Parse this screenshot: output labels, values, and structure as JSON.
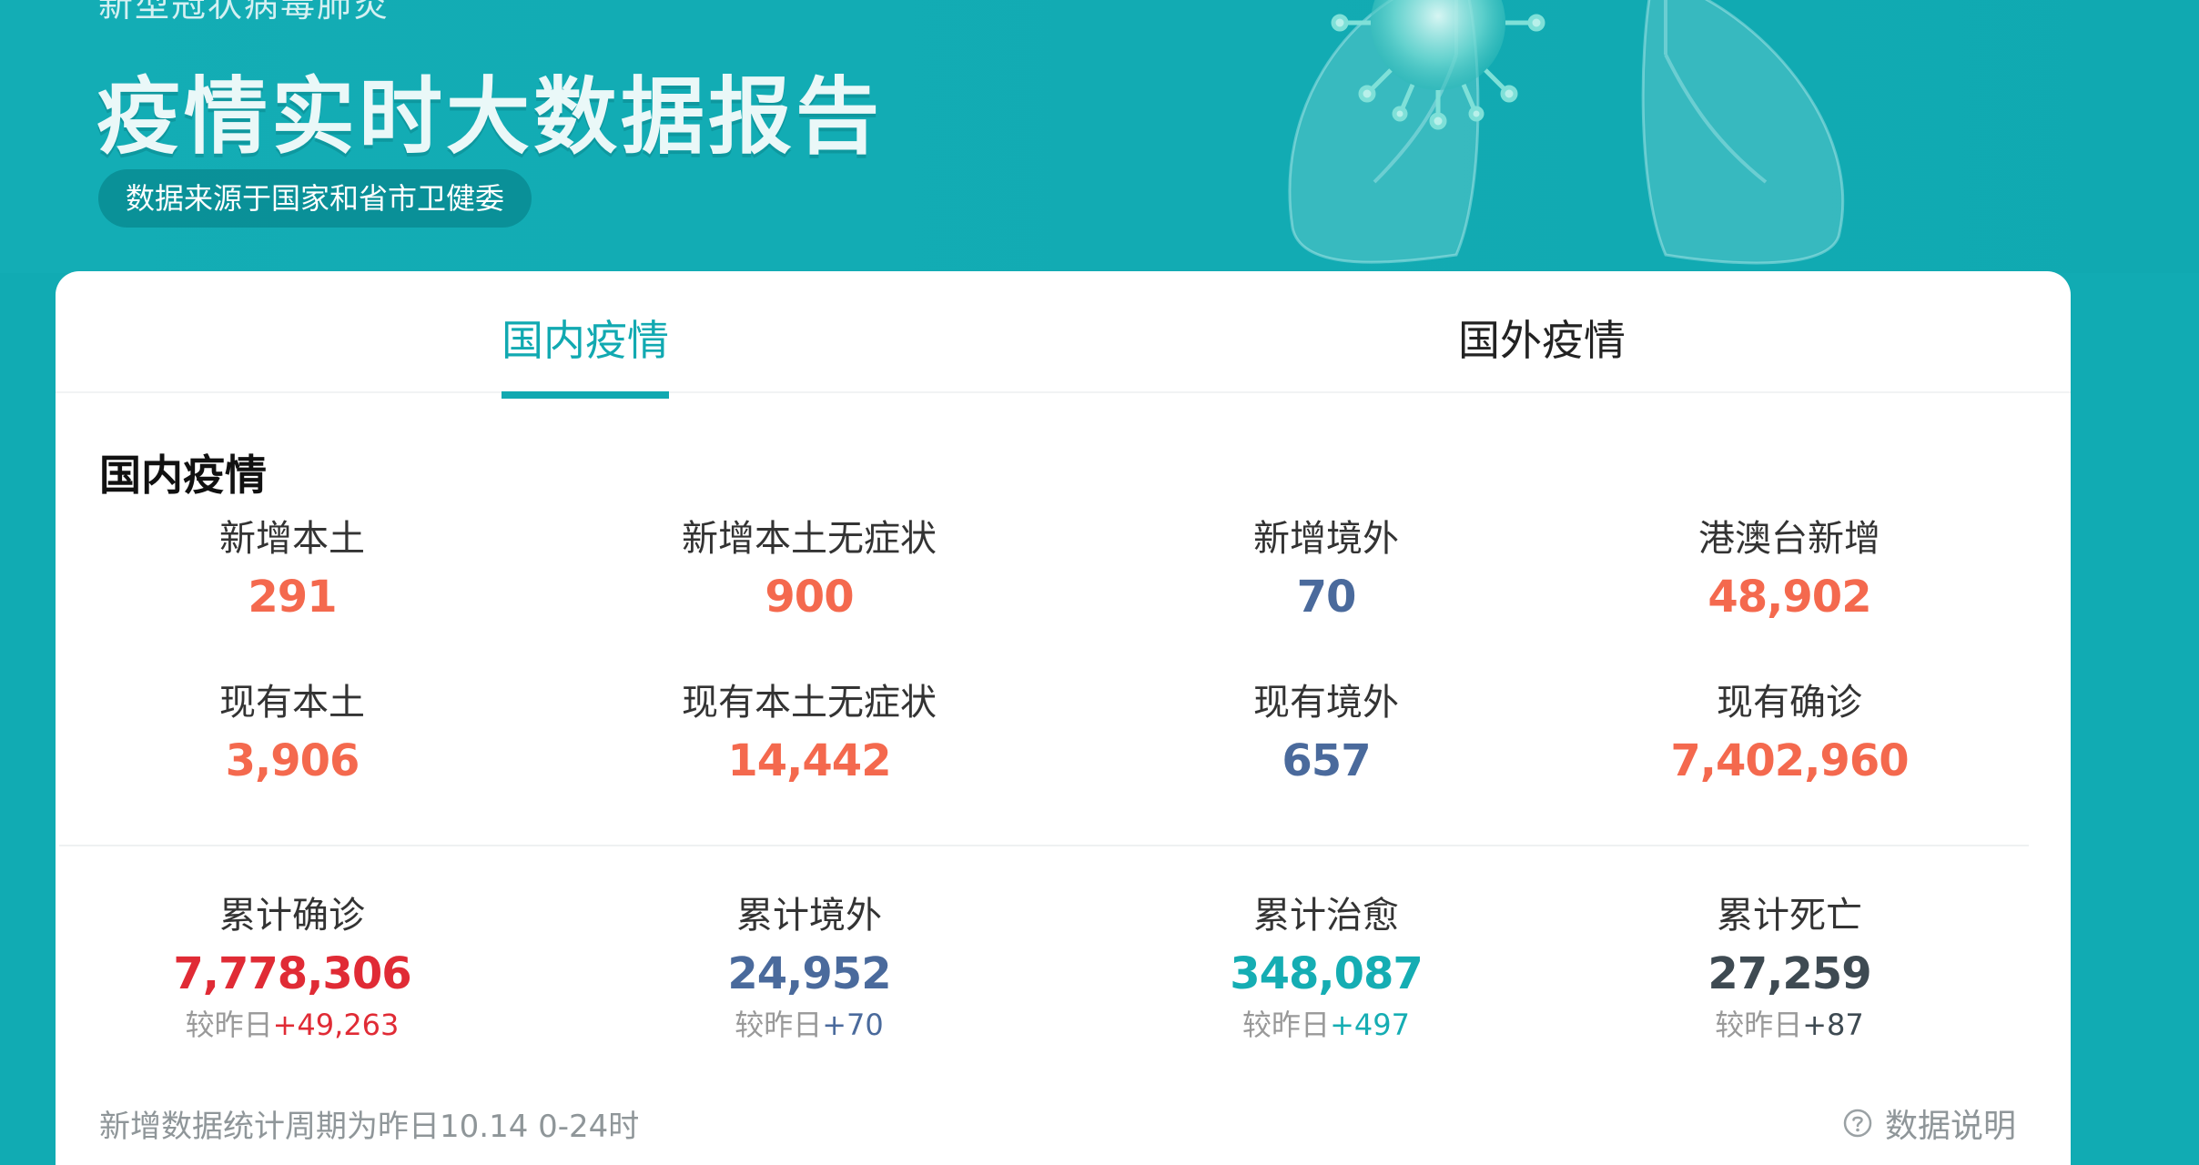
{
  "banner": {
    "subtitle": "新型冠状病毒肺炎",
    "title": "疫情实时大数据报告",
    "source": "数据来源于国家和省市卫健委"
  },
  "tabs": [
    {
      "label": "国内疫情",
      "active": true
    },
    {
      "label": "国外疫情",
      "active": false
    }
  ],
  "section_title": "国内疫情",
  "stats_today": [
    {
      "label": "新增本土",
      "value": "291",
      "color": "#f4694e"
    },
    {
      "label": "新增本土无症状",
      "value": "900",
      "color": "#f4694e"
    },
    {
      "label": "新增境外",
      "value": "70",
      "color": "#4a6a9c"
    },
    {
      "label": "港澳台新增",
      "value": "48,902",
      "color": "#f4694e"
    }
  ],
  "stats_current": [
    {
      "label": "现有本土",
      "value": "3,906",
      "color": "#f4694e"
    },
    {
      "label": "现有本土无症状",
      "value": "14,442",
      "color": "#f4694e"
    },
    {
      "label": "现有境外",
      "value": "657",
      "color": "#4a6a9c"
    },
    {
      "label": "现有确诊",
      "value": "7,402,960",
      "color": "#f4694e"
    }
  ],
  "stats_cumulative": [
    {
      "label": "累计确诊",
      "value": "7,778,306",
      "color": "#e02b35",
      "change_prefix": "较昨日",
      "change": "+49,263",
      "change_color": "#e02b35"
    },
    {
      "label": "累计境外",
      "value": "24,952",
      "color": "#4a6a9c",
      "change_prefix": "较昨日",
      "change": "+70",
      "change_color": "#4a6a9c"
    },
    {
      "label": "累计治愈",
      "value": "348,087",
      "color": "#15adb3",
      "change_prefix": "较昨日",
      "change": "+497",
      "change_color": "#15adb3"
    },
    {
      "label": "累计死亡",
      "value": "27,259",
      "color": "#3e4a52",
      "change_prefix": "较昨日",
      "change": "+87",
      "change_color": "#3e4a52"
    }
  ],
  "footnote": "新增数据统计周期为昨日10.14 0-24时",
  "explain_link": "数据说明",
  "icons": {
    "help": "question-circle-icon",
    "virus": "virus-icon",
    "lungs": "lungs-illustration"
  }
}
